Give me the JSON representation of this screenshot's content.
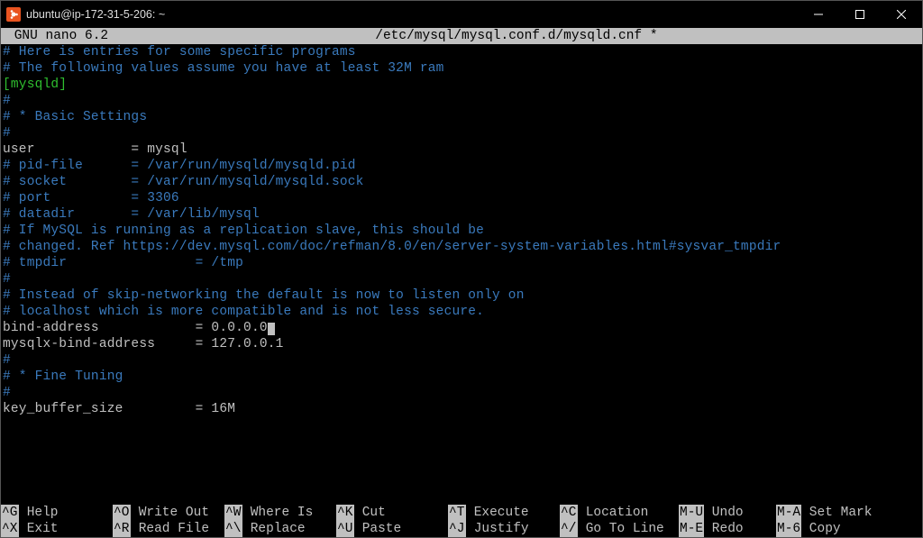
{
  "titlebar": {
    "title": "ubuntu@ip-172-31-5-206: ~"
  },
  "nano": {
    "app": " GNU nano 6.2 ",
    "file": "/etc/mysql/mysql.conf.d/mysqld.cnf *"
  },
  "lines": [
    {
      "cls": "c-comment",
      "text": "# Here is entries for some specific programs"
    },
    {
      "cls": "c-comment",
      "text": "# The following values assume you have at least 32M ram"
    },
    {
      "cls": "c-comment",
      "text": ""
    },
    {
      "cls": "c-section",
      "text": "[mysqld]"
    },
    {
      "cls": "c-comment",
      "text": "#"
    },
    {
      "cls": "c-comment",
      "text": "# * Basic Settings"
    },
    {
      "cls": "c-comment",
      "text": "#"
    },
    {
      "cls": "c-plain",
      "text": "user            = mysql"
    },
    {
      "cls": "c-comment",
      "text": "# pid-file      = /var/run/mysqld/mysqld.pid"
    },
    {
      "cls": "c-comment",
      "text": "# socket        = /var/run/mysqld/mysqld.sock"
    },
    {
      "cls": "c-comment",
      "text": "# port          = 3306"
    },
    {
      "cls": "c-comment",
      "text": "# datadir       = /var/lib/mysql"
    },
    {
      "cls": "c-comment",
      "text": ""
    },
    {
      "cls": "c-comment",
      "text": ""
    },
    {
      "cls": "c-comment",
      "text": "# If MySQL is running as a replication slave, this should be"
    },
    {
      "cls": "c-comment",
      "text": "# changed. Ref https://dev.mysql.com/doc/refman/8.0/en/server-system-variables.html#sysvar_tmpdir"
    },
    {
      "cls": "c-comment",
      "text": "# tmpdir                = /tmp"
    },
    {
      "cls": "c-comment",
      "text": "#"
    },
    {
      "cls": "c-comment",
      "text": "# Instead of skip-networking the default is now to listen only on"
    },
    {
      "cls": "c-comment",
      "text": "# localhost which is more compatible and is not less secure."
    },
    {
      "cls": "c-plain",
      "text": "bind-address            = 0.0.0.0",
      "cursor": true
    },
    {
      "cls": "c-plain",
      "text": "mysqlx-bind-address     = 127.0.0.1"
    },
    {
      "cls": "c-comment",
      "text": "#"
    },
    {
      "cls": "c-comment",
      "text": "# * Fine Tuning"
    },
    {
      "cls": "c-comment",
      "text": "#"
    },
    {
      "cls": "c-plain",
      "text": "key_buffer_size         = 16M"
    }
  ],
  "footer": {
    "rows": [
      [
        {
          "key": "^G",
          "desc": " Help"
        },
        {
          "key": "^O",
          "desc": " Write Out"
        },
        {
          "key": "^W",
          "desc": " Where Is"
        },
        {
          "key": "^K",
          "desc": " Cut"
        },
        {
          "key": "^T",
          "desc": " Execute"
        },
        {
          "key": "^C",
          "desc": " Location"
        },
        {
          "key": "M-U",
          "desc": " Undo"
        },
        {
          "key": "M-A",
          "desc": " Set Mark"
        }
      ],
      [
        {
          "key": "^X",
          "desc": " Exit"
        },
        {
          "key": "^R",
          "desc": " Read File"
        },
        {
          "key": "^\\",
          "desc": " Replace"
        },
        {
          "key": "^U",
          "desc": " Paste"
        },
        {
          "key": "^J",
          "desc": " Justify"
        },
        {
          "key": "^/",
          "desc": " Go To Line"
        },
        {
          "key": "M-E",
          "desc": " Redo"
        },
        {
          "key": "M-6",
          "desc": " Copy"
        }
      ]
    ]
  }
}
